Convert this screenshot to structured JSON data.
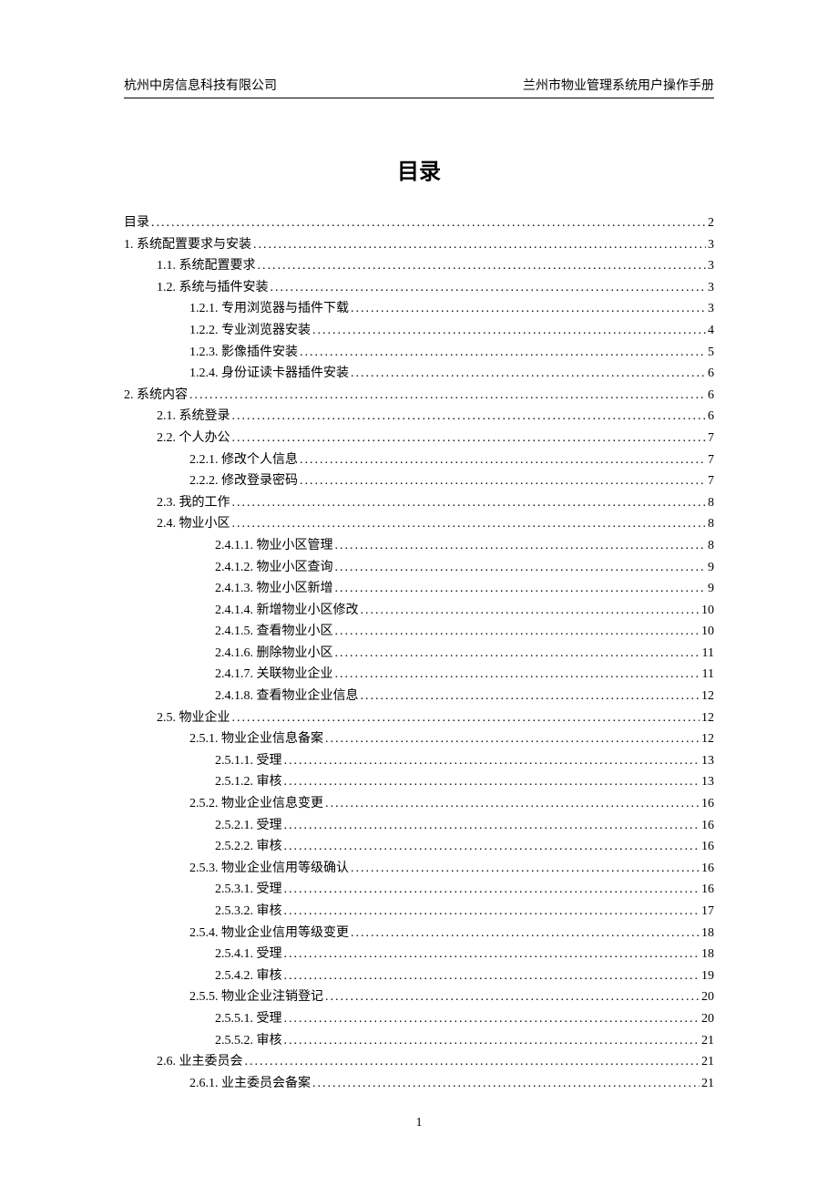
{
  "header": {
    "left": "杭州中房信息科技有限公司",
    "right": "兰州市物业管理系统用户操作手册"
  },
  "title": "目录",
  "toc": [
    {
      "level": 0,
      "label": "目录",
      "page": "2"
    },
    {
      "level": 0,
      "label": "1. 系统配置要求与安装",
      "page": "3"
    },
    {
      "level": 1,
      "label": "1.1. 系统配置要求",
      "page": "3"
    },
    {
      "level": 1,
      "label": "1.2. 系统与插件安装",
      "page": "3"
    },
    {
      "level": 2,
      "label": "1.2.1. 专用浏览器与插件下载",
      "page": "3"
    },
    {
      "level": 2,
      "label": "1.2.2. 专业浏览器安装",
      "page": "4"
    },
    {
      "level": 2,
      "label": "1.2.3. 影像插件安装",
      "page": "5"
    },
    {
      "level": 2,
      "label": "1.2.4. 身份证读卡器插件安装",
      "page": "6"
    },
    {
      "level": 0,
      "label": "2. 系统内容",
      "page": "6"
    },
    {
      "level": 1,
      "label": "2.1. 系统登录",
      "page": "6"
    },
    {
      "level": 1,
      "label": "2.2. 个人办公",
      "page": "7"
    },
    {
      "level": 2,
      "label": "2.2.1. 修改个人信息",
      "page": "7"
    },
    {
      "level": 2,
      "label": "2.2.2. 修改登录密码",
      "page": "7"
    },
    {
      "level": 1,
      "label": "2.3. 我的工作",
      "page": "8"
    },
    {
      "level": 1,
      "label": "2.4. 物业小区",
      "page": "8"
    },
    {
      "level": 3,
      "label": "2.4.1.1. 物业小区管理",
      "page": "8"
    },
    {
      "level": 3,
      "label": "2.4.1.2. 物业小区查询",
      "page": "9"
    },
    {
      "level": 3,
      "label": "2.4.1.3. 物业小区新增",
      "page": "9"
    },
    {
      "level": 3,
      "label": "2.4.1.4. 新增物业小区修改",
      "page": "10"
    },
    {
      "level": 3,
      "label": "2.4.1.5. 查看物业小区",
      "page": "10"
    },
    {
      "level": 3,
      "label": "2.4.1.6. 删除物业小区",
      "page": "11"
    },
    {
      "level": 3,
      "label": "2.4.1.7. 关联物业企业",
      "page": "11"
    },
    {
      "level": 3,
      "label": "2.4.1.8. 查看物业企业信息",
      "page": "12"
    },
    {
      "level": 1,
      "label": "2.5. 物业企业",
      "page": "12"
    },
    {
      "level": 2,
      "label": "2.5.1. 物业企业信息备案",
      "page": "12"
    },
    {
      "level": 3,
      "label": "2.5.1.1. 受理",
      "page": "13"
    },
    {
      "level": 3,
      "label": "2.5.1.2. 审核",
      "page": "13"
    },
    {
      "level": 2,
      "label": "2.5.2. 物业企业信息变更",
      "page": "16"
    },
    {
      "level": 3,
      "label": "2.5.2.1. 受理",
      "page": "16"
    },
    {
      "level": 3,
      "label": "2.5.2.2. 审核",
      "page": "16"
    },
    {
      "level": 2,
      "label": "2.5.3. 物业企业信用等级确认",
      "page": "16"
    },
    {
      "level": 3,
      "label": "2.5.3.1. 受理",
      "page": "16"
    },
    {
      "level": 3,
      "label": "2.5.3.2. 审核",
      "page": "17"
    },
    {
      "level": 2,
      "label": "2.5.4. 物业企业信用等级变更",
      "page": "18"
    },
    {
      "level": 3,
      "label": "2.5.4.1. 受理",
      "page": "18"
    },
    {
      "level": 3,
      "label": "2.5.4.2. 审核",
      "page": "19"
    },
    {
      "level": 2,
      "label": "2.5.5. 物业企业注销登记",
      "page": "20"
    },
    {
      "level": 3,
      "label": "2.5.5.1. 受理",
      "page": "20"
    },
    {
      "level": 3,
      "label": "2.5.5.2. 审核",
      "page": "21"
    },
    {
      "level": 1,
      "label": "2.6. 业主委员会",
      "page": "21"
    },
    {
      "level": 2,
      "label": "2.6.1. 业主委员会备案",
      "page": "21"
    }
  ],
  "footer": "1"
}
